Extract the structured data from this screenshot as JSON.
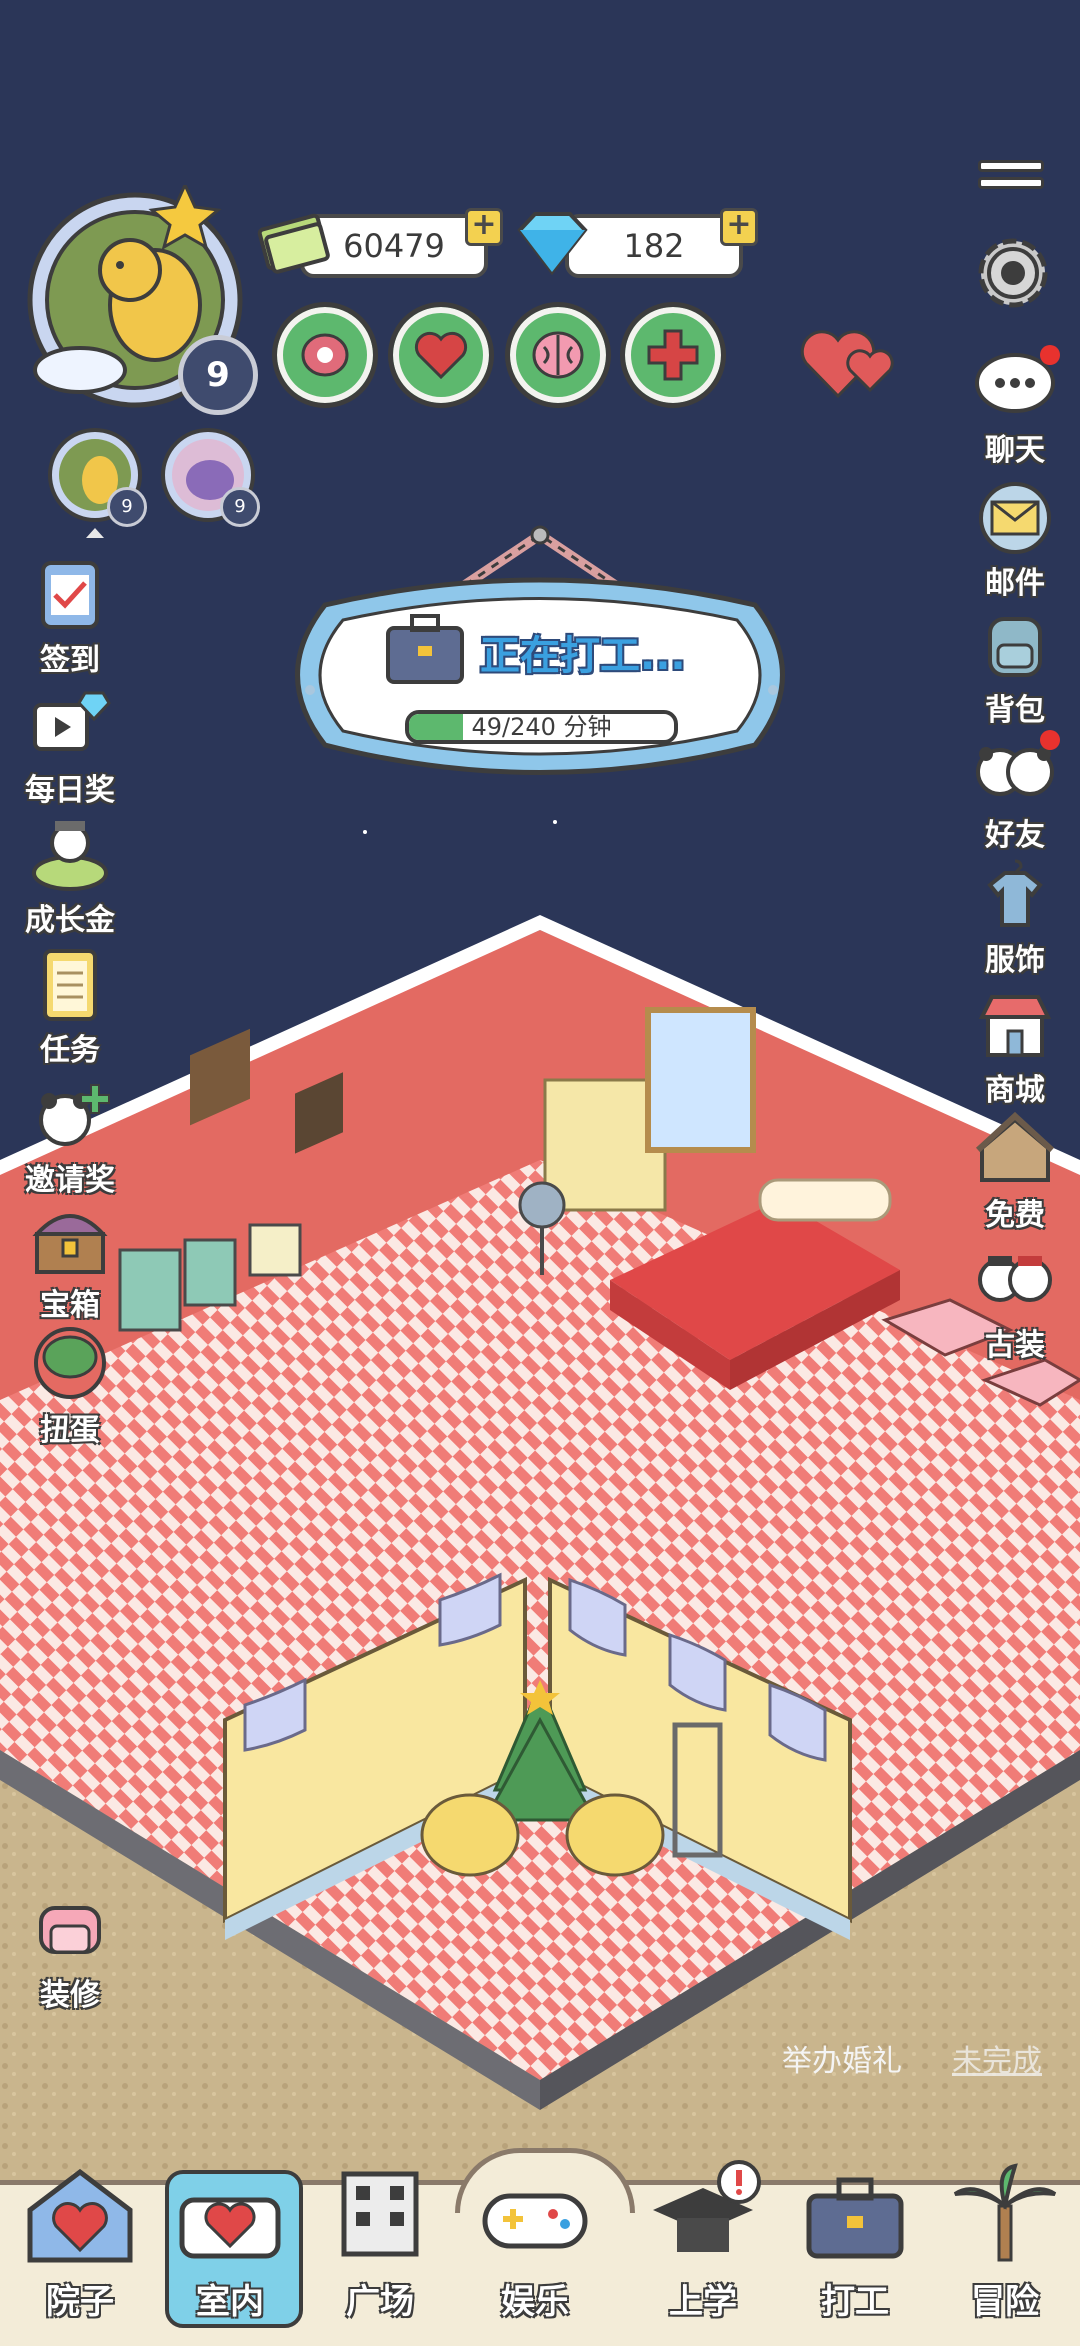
{
  "currency": {
    "coins": "60479",
    "gems": "182"
  },
  "avatar": {
    "level": "9",
    "pet1_level": "9",
    "pet2_level": "9"
  },
  "work": {
    "title": "正在打工...",
    "progress_text": "49/240 分钟",
    "progress_fraction": 0.204
  },
  "left_menu": [
    "签到",
    "每日奖",
    "成长金",
    "任务",
    "邀请奖",
    "宝箱",
    "扭蛋",
    "装修"
  ],
  "right_menu": [
    "聊天",
    "邮件",
    "背包",
    "好友",
    "服饰",
    "商城",
    "免费",
    "古装"
  ],
  "quest": {
    "name": "举办婚礼",
    "status": "未完成"
  },
  "bottom_nav": [
    "院子",
    "室内",
    "广场",
    "娱乐",
    "上学",
    "打工",
    "冒险"
  ],
  "colors": {
    "sky": "#2b3658",
    "wall": "#e36a62",
    "floor_a": "#f07c77",
    "floor_b": "#fbe9e4",
    "accent_green": "#5db86e"
  }
}
